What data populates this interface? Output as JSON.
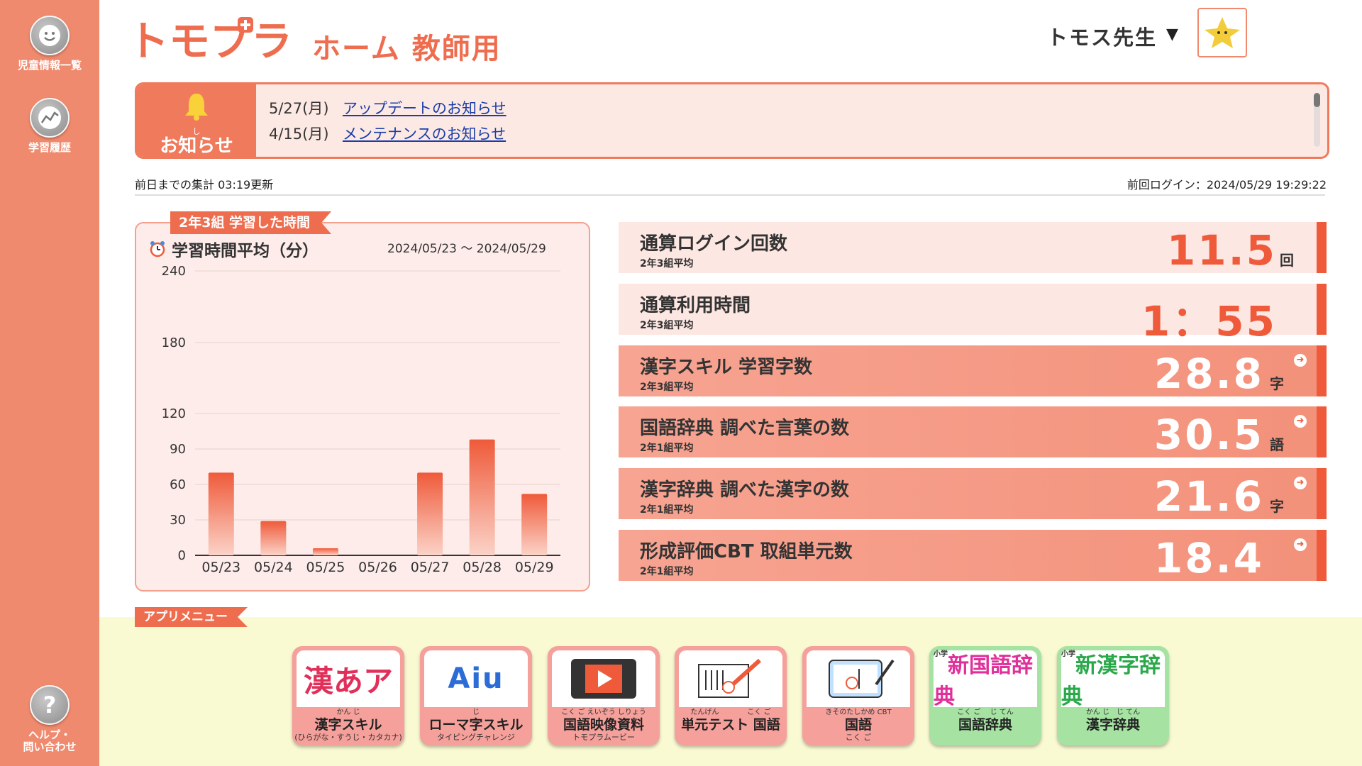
{
  "sidebar": {
    "items": [
      {
        "label": "児童情報一覧",
        "icon": "smiley-icon"
      },
      {
        "label": "学習履歴",
        "icon": "trend-line-icon"
      }
    ],
    "help": {
      "label_line1": "ヘルプ・",
      "label_line2": "問い合わせ",
      "icon": "question-icon"
    }
  },
  "header": {
    "logo_text": "トモプラ",
    "title": "ホーム 教師用",
    "user_name": "トモス先生",
    "caret": "▼"
  },
  "notice": {
    "ruby": "し",
    "label": "お知らせ",
    "items": [
      {
        "date": "5/27(月)",
        "text": "アップデートのお知らせ"
      },
      {
        "date": "4/15(月)",
        "text": "メンテナンスのお知らせ"
      }
    ]
  },
  "meta": {
    "updated": "前日までの集計 03:19更新",
    "last_login": "前回ログイン：2024/05/29 19:29:22"
  },
  "chart_panel": {
    "ribbon": "2年3組 学習した時間",
    "heading": "学習時間平均（分）",
    "range": "2024/05/23 ～ 2024/05/29"
  },
  "chart_data": {
    "type": "bar",
    "title": "学習時間平均（分）",
    "categories": [
      "05/23",
      "05/24",
      "05/25",
      "05/26",
      "05/27",
      "05/28",
      "05/29"
    ],
    "values": [
      70,
      29,
      6,
      0,
      70,
      98,
      52
    ],
    "yticks": [
      0,
      30,
      60,
      90,
      120,
      180,
      240
    ],
    "ylim": [
      0,
      240
    ],
    "colors": {
      "bar_top": "#ef5a3a",
      "bar_bottom": "#fbd3c8",
      "axis": "#333333",
      "grid": "#e6d2cd"
    }
  },
  "stats": [
    {
      "title": "通算ログイン回数",
      "sub": "2年3組平均",
      "value": "11.5",
      "unit": "回",
      "style": "light",
      "link": false
    },
    {
      "title": "通算利用時間",
      "sub": "2年3組平均",
      "value": "1：55",
      "unit": "",
      "style": "light",
      "link": false
    },
    {
      "title": "漢字スキル 学習字数",
      "sub": "2年3組平均",
      "value": "28.8",
      "unit": "字",
      "style": "dark",
      "link": true
    },
    {
      "title": "国語辞典 調べた言葉の数",
      "sub": "2年1組平均",
      "value": "30.5",
      "unit": "語",
      "style": "dark",
      "link": true
    },
    {
      "title": "漢字辞典 調べた漢字の数",
      "sub": "2年1組平均",
      "value": "21.6",
      "unit": "字",
      "style": "dark",
      "link": true
    },
    {
      "title": "形成評価CBT 取組単元数",
      "sub": "2年1組平均",
      "value": "18.4",
      "unit": "",
      "style": "dark",
      "link": true
    }
  ],
  "app_menu": {
    "label": "アプリメニュー",
    "apps": [
      {
        "ruby": "かん じ",
        "name": "漢字スキル",
        "small": "(ひらがな・すうじ・カタカナ)",
        "art": "漢あア",
        "color": "red"
      },
      {
        "ruby": "じ",
        "name": "ローマ字スキル",
        "small": "タイピングチャレンジ",
        "art": "Aiu",
        "color": "red"
      },
      {
        "ruby": "こく ご えいぞう しりょう",
        "name": "国語映像資料",
        "small": "トモプラムービー",
        "art": "play",
        "color": "red"
      },
      {
        "ruby": "たんげん　　　　こく ご",
        "name": "単元テスト 国語",
        "small": "",
        "art": "test",
        "color": "red"
      },
      {
        "ruby": "きそのたしかめ CBT",
        "name": "国語",
        "small": "こく ご",
        "art": "cbt",
        "color": "red"
      },
      {
        "ruby": "こく ご　 じ てん",
        "name": "国語辞典",
        "small": "",
        "art": "新国語辞典",
        "art_small": "小学",
        "color": "green"
      },
      {
        "ruby": "かん じ　じ てん",
        "name": "漢字辞典",
        "small": "",
        "art": "新漢字辞典",
        "art_small": "小学",
        "color": "green"
      }
    ]
  }
}
